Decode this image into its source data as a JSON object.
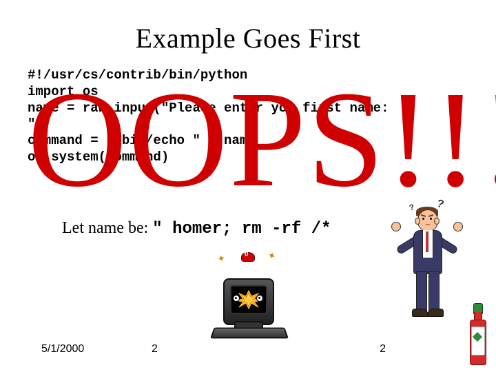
{
  "title": "Example Goes First",
  "code": "#!/usr/cs/contrib/bin/python\nimport os\nname = raw_input(\"Please enter you first name:\n\")\ncommand = \"/bin/echo \" + name\nos.system(command)",
  "overlay": "OOPS!!!",
  "example": {
    "label": "Let name be:  ",
    "value": "\" homer; rm -rf /*"
  },
  "footer": {
    "date": "5/1/2000",
    "page_left": "2",
    "page_right": "2"
  },
  "clipart": {
    "businessman": "confused-businessman-shrugging",
    "computer": "exploding-crt-computer",
    "bottle": "hot-sauce-bottle"
  },
  "q1": "?",
  "q2": "?",
  "spark": "✦"
}
